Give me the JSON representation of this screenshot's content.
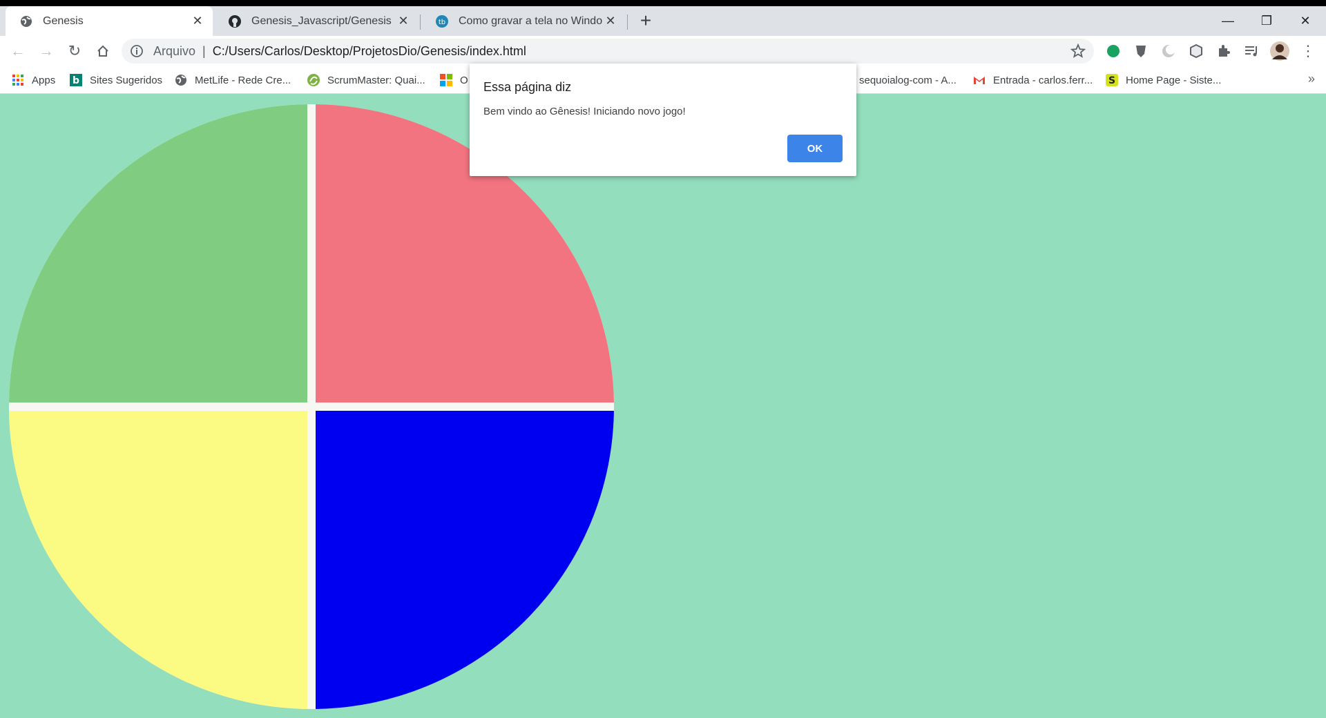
{
  "tabs": [
    {
      "title": "Genesis",
      "active": true
    },
    {
      "title": "Genesis_Javascript/Genesis at master",
      "active": false
    },
    {
      "title": "Como gravar a tela no Windows",
      "active": false
    }
  ],
  "toolbar": {
    "scheme_label": "Arquivo",
    "url": "C:/Users/Carlos/Desktop/ProjetosDio/Genesis/index.html"
  },
  "bookmarks": [
    {
      "label": "Apps"
    },
    {
      "label": "Sites Sugeridos"
    },
    {
      "label": "MetLife - Rede Cre..."
    },
    {
      "label": "ScrumMaster: Quai..."
    },
    {
      "label": "O"
    },
    {
      "label": "sequoialog-com - A..."
    },
    {
      "label": "Entrada - carlos.ferr..."
    },
    {
      "label": "Home Page - Siste..."
    }
  ],
  "dialog": {
    "title": "Essa página diz",
    "message": "Bem vindo ao Gênesis! Iniciando novo jogo!",
    "ok_label": "OK"
  },
  "game": {
    "quadrants": [
      {
        "name": "green",
        "color": "#80cc80"
      },
      {
        "name": "red",
        "color": "#f27480"
      },
      {
        "name": "yellow",
        "color": "#fbfb84"
      },
      {
        "name": "blue",
        "color": "#0000f0"
      }
    ],
    "background": "#93dfbd"
  }
}
